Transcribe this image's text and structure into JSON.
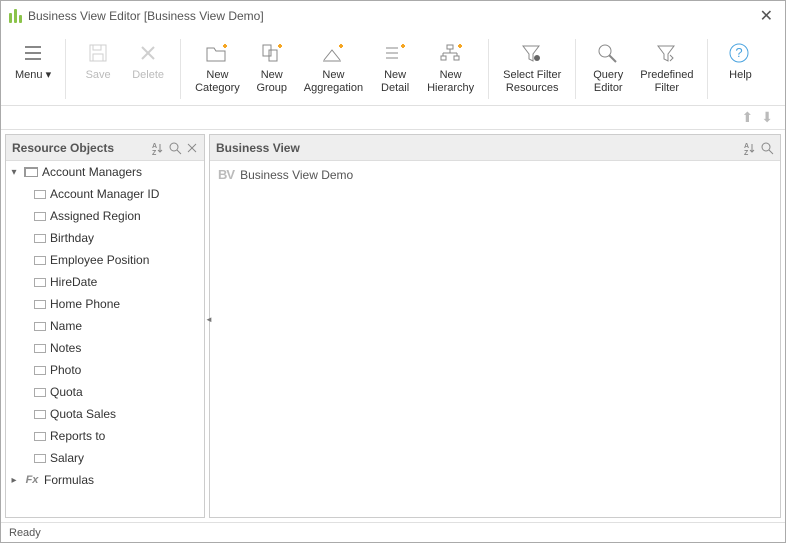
{
  "title": "Business View Editor [Business View Demo]",
  "toolbar": {
    "menu": "Menu",
    "save": "Save",
    "delete": "Delete",
    "new_category": "New\nCategory",
    "new_group": "New\nGroup",
    "new_aggregation": "New\nAggregation",
    "new_detail": "New\nDetail",
    "new_hierarchy": "New\nHierarchy",
    "select_filter_resources": "Select Filter\nResources",
    "query_editor": "Query\nEditor",
    "predefined_filter": "Predefined\nFilter",
    "help": "Help"
  },
  "left_panel": {
    "title": "Resource Objects",
    "root": "Account Managers",
    "fields": [
      "Account Manager ID",
      "Assigned Region",
      "Birthday",
      "Employee Position",
      "HireDate",
      "Home Phone",
      "Name",
      "Notes",
      "Photo",
      "Quota",
      "Quota Sales",
      "Reports to",
      "Salary"
    ],
    "formulas": "Formulas"
  },
  "right_panel": {
    "title": "Business View",
    "item": "Business View Demo"
  },
  "status": "Ready"
}
